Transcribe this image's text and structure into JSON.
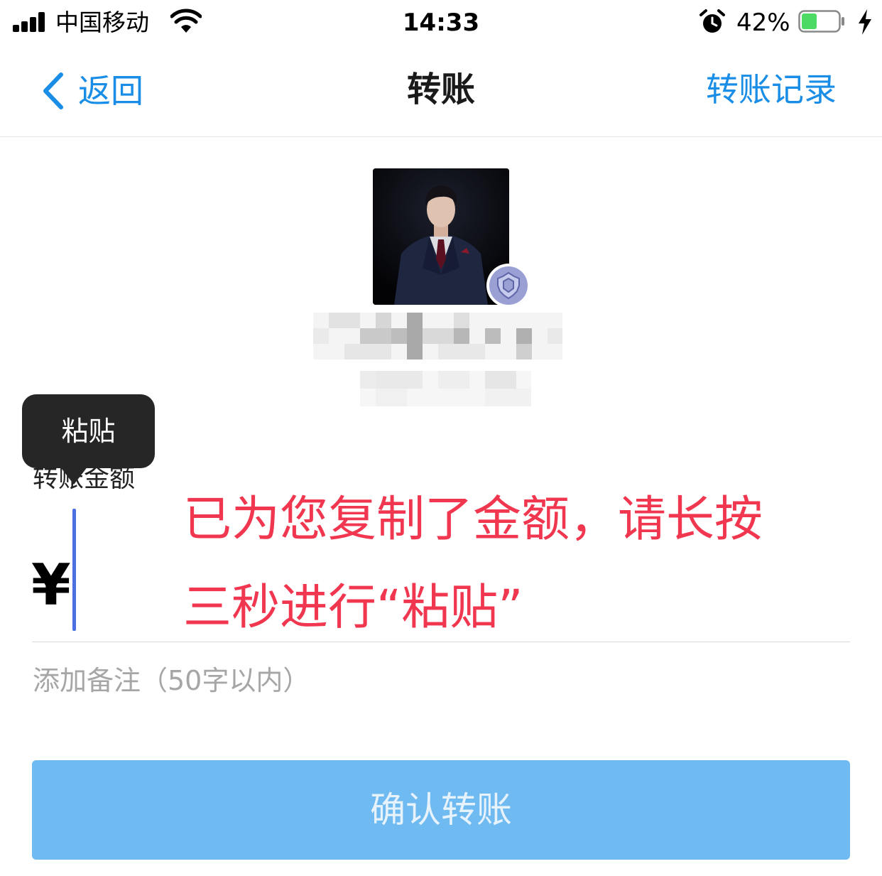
{
  "status_bar": {
    "carrier": "中国移动",
    "time": "14:33",
    "battery_percent": "42%",
    "battery_level": 0.42,
    "battery_color": "#4cd964"
  },
  "nav": {
    "back_label": "返回",
    "title": "转账",
    "right_label": "转账记录",
    "accent": "#1a8ee6"
  },
  "recipient": {
    "avatar_icon": "person-photo",
    "badge_icon": "verified-badge-icon"
  },
  "amount": {
    "label": "转账金额",
    "currency_symbol": "¥",
    "value": ""
  },
  "tooltip": {
    "paste_label": "粘贴"
  },
  "instruction": {
    "line1": "已为您复制了金额，请长按",
    "line2": "三秒进行“粘贴”",
    "color": "#f0374f"
  },
  "note": {
    "placeholder": "添加备注（50字以内）"
  },
  "confirm": {
    "label": "确认转账",
    "color": "#6fbaf0"
  }
}
